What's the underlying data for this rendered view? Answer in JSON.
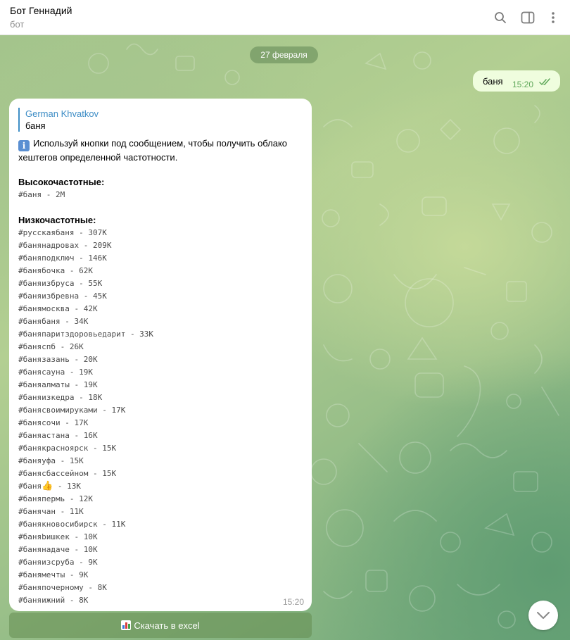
{
  "header": {
    "title": "Бот Геннадий",
    "subtitle": "бот"
  },
  "date_pill": "27 февраля",
  "outgoing": {
    "text": "баня",
    "time": "15:20"
  },
  "incoming": {
    "reply_author": "German Khvatkov",
    "reply_text": "баня",
    "info_text": "Используй кнопки под сообщением, чтобы получить облако хештегов определенной частотности.",
    "high_heading": "Высокочастотные:",
    "high_tags": [
      "#баня - 2M"
    ],
    "low_heading": "Низкочастотные:",
    "low_tags": [
      "#русскаябаня - 307K",
      "#банянадровах - 209K",
      "#баняподключ - 146K",
      "#банябочка - 62K",
      "#баняизбруса - 55K",
      "#баняизбревна - 45K",
      "#банямосква - 42K",
      "#банябаня - 34K",
      "#баняпаритздоровьедарит - 33K",
      "#баняспб - 26K",
      "#банязазань - 20K",
      "#банясауна - 19K",
      "#баняалматы - 19K",
      "#баняизкедра - 18K",
      "#банясвоимируками - 17K",
      "#банясочи - 17K",
      "#баняастана - 16K",
      "#банякрасноярск - 15K",
      "#баняуфа - 15K",
      "#банясбассейном - 15K",
      "#баня",
      "#баняпермь - 12K",
      "#банячан - 11K",
      "#банякновосибирск - 11K",
      "#баняbишкек - 10K",
      "#банянадаче - 10K",
      "#баняизсруба - 9K",
      "#банямечты - 9K",
      "#баняпочерному - 8K",
      "#баняижний - 8K"
    ],
    "thumb_tag_suffix": " - 13K",
    "time": "15:20"
  },
  "keyboard_button": "Скачать в excel",
  "icons": {
    "search": "search-icon",
    "sidebar": "sidebar-toggle-icon",
    "more": "more-vertical-icon",
    "info": "info-icon",
    "thumb": "thumbs-up-emoji",
    "chart": "bar-chart-icon",
    "scroll": "chevron-down-icon",
    "read": "double-check-icon"
  },
  "colors": {
    "accent": "#3f8ec6",
    "outgoing_bubble": "#effdde",
    "read_ticks": "#5fa85a"
  }
}
